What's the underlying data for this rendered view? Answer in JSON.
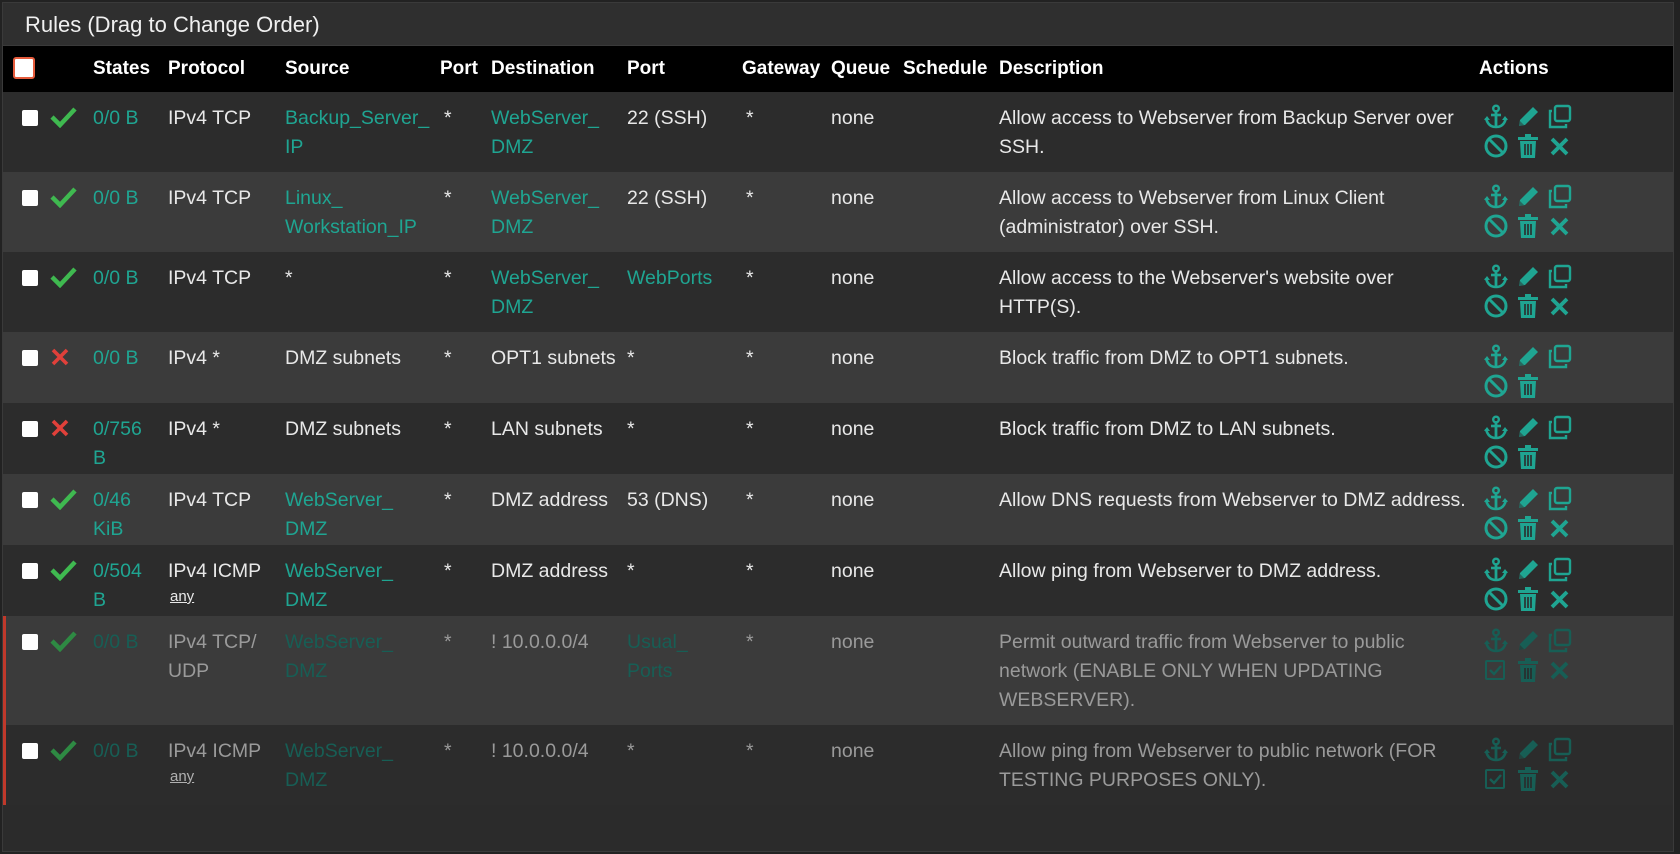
{
  "panel": {
    "title": "Rules (Drag to Change Order)"
  },
  "columns": [
    "States",
    "Protocol",
    "Source",
    "Port",
    "Destination",
    "Port",
    "Gateway",
    "Queue",
    "Schedule",
    "Description",
    "Actions"
  ],
  "colors": {
    "accent": "#1fa592",
    "pass": "#3fb950",
    "block": "#e0403a",
    "disabled_marker": "#c0392b"
  },
  "rules": [
    {
      "status": "pass",
      "disabled": false,
      "states": "0/0 B",
      "protocol": "IPv4 TCP",
      "protocol_sub": "",
      "source": "Backup_Server_ IP",
      "source_link": true,
      "source_port": "*",
      "destination": "WebServer_ DMZ",
      "destination_link": true,
      "dest_port": "22 (SSH)",
      "dest_port_link": false,
      "gateway": "*",
      "queue": "none",
      "schedule": "",
      "description": "Allow access to Webserver from Backup Server over SSH.",
      "actions": [
        "anchor-icon",
        "pencil-icon",
        "copy-icon",
        "ban-icon",
        "trash-icon",
        "times-icon"
      ]
    },
    {
      "status": "pass",
      "disabled": false,
      "states": "0/0 B",
      "protocol": "IPv4 TCP",
      "protocol_sub": "",
      "source": "Linux_ Workstation_IP",
      "source_link": true,
      "source_port": "*",
      "destination": "WebServer_ DMZ",
      "destination_link": true,
      "dest_port": "22 (SSH)",
      "dest_port_link": false,
      "gateway": "*",
      "queue": "none",
      "schedule": "",
      "description": "Allow access to Webserver from Linux Client (administrator) over SSH.",
      "actions": [
        "anchor-icon",
        "pencil-icon",
        "copy-icon",
        "ban-icon",
        "trash-icon",
        "times-icon"
      ]
    },
    {
      "status": "pass",
      "disabled": false,
      "states": "0/0 B",
      "protocol": "IPv4 TCP",
      "protocol_sub": "",
      "source": "*",
      "source_link": false,
      "source_port": "*",
      "destination": "WebServer_ DMZ",
      "destination_link": true,
      "dest_port": "WebPorts",
      "dest_port_link": true,
      "gateway": "*",
      "queue": "none",
      "schedule": "",
      "description": "Allow access to the Webserver's website over HTTP(S).",
      "actions": [
        "anchor-icon",
        "pencil-icon",
        "copy-icon",
        "ban-icon",
        "trash-icon",
        "times-icon"
      ]
    },
    {
      "status": "block",
      "disabled": false,
      "states": "0/0 B",
      "protocol": "IPv4 *",
      "protocol_sub": "",
      "source": "DMZ subnets",
      "source_link": false,
      "source_port": "*",
      "destination": "OPT1 subnets",
      "destination_link": false,
      "dest_port": "*",
      "dest_port_link": false,
      "gateway": "*",
      "queue": "none",
      "schedule": "",
      "description": "Block traffic from DMZ to OPT1 subnets.",
      "actions": [
        "anchor-icon",
        "pencil-icon",
        "copy-icon",
        "ban-icon",
        "trash-icon"
      ]
    },
    {
      "status": "block",
      "disabled": false,
      "states": "0/756 B",
      "protocol": "IPv4 *",
      "protocol_sub": "",
      "source": "DMZ subnets",
      "source_link": false,
      "source_port": "*",
      "destination": "LAN subnets",
      "destination_link": false,
      "dest_port": "*",
      "dest_port_link": false,
      "gateway": "*",
      "queue": "none",
      "schedule": "",
      "description": "Block traffic from DMZ to LAN subnets.",
      "actions": [
        "anchor-icon",
        "pencil-icon",
        "copy-icon",
        "ban-icon",
        "trash-icon"
      ]
    },
    {
      "status": "pass",
      "disabled": false,
      "states": "0/46 KiB",
      "protocol": "IPv4 TCP",
      "protocol_sub": "",
      "source": "WebServer_ DMZ",
      "source_link": true,
      "source_port": "*",
      "destination": "DMZ address",
      "destination_link": false,
      "dest_port": "53 (DNS)",
      "dest_port_link": false,
      "gateway": "*",
      "queue": "none",
      "schedule": "",
      "description": "Allow DNS requests from Webserver to DMZ address.",
      "actions": [
        "anchor-icon",
        "pencil-icon",
        "copy-icon",
        "ban-icon",
        "trash-icon",
        "times-icon"
      ]
    },
    {
      "status": "pass",
      "disabled": false,
      "states": "0/504 B",
      "protocol": "IPv4 ICMP",
      "protocol_sub": "any",
      "source": "WebServer_ DMZ",
      "source_link": true,
      "source_port": "*",
      "destination": "DMZ address",
      "destination_link": false,
      "dest_port": "*",
      "dest_port_link": false,
      "gateway": "*",
      "queue": "none",
      "schedule": "",
      "description": "Allow ping from Webserver to DMZ address.",
      "actions": [
        "anchor-icon",
        "pencil-icon",
        "copy-icon",
        "ban-icon",
        "trash-icon",
        "times-icon"
      ]
    },
    {
      "status": "pass",
      "disabled": true,
      "states": "0/0 B",
      "protocol": "IPv4 TCP/ UDP",
      "protocol_sub": "",
      "source": "WebServer_ DMZ",
      "source_link": true,
      "source_port": "*",
      "destination": "! 10.0.0.0/4",
      "destination_link": false,
      "dest_port": "Usual_ Ports",
      "dest_port_link": true,
      "gateway": "*",
      "queue": "none",
      "schedule": "",
      "description": "Permit outward traffic from Webserver to public network (ENABLE ONLY WHEN UPDATING WEBSERVER).",
      "actions": [
        "anchor-icon",
        "pencil-icon",
        "copy-icon",
        "check-square-icon",
        "trash-icon",
        "times-icon"
      ]
    },
    {
      "status": "pass",
      "disabled": true,
      "states": "0/0 B",
      "protocol": "IPv4 ICMP",
      "protocol_sub": "any",
      "source": "WebServer_ DMZ",
      "source_link": true,
      "source_port": "*",
      "destination": "! 10.0.0.0/4",
      "destination_link": false,
      "dest_port": "*",
      "dest_port_link": false,
      "gateway": "*",
      "queue": "none",
      "schedule": "",
      "description": "Allow ping from Webserver to public network (FOR TESTING PURPOSES ONLY).",
      "actions": [
        "anchor-icon",
        "pencil-icon",
        "copy-icon",
        "check-square-icon",
        "trash-icon",
        "times-icon"
      ]
    }
  ]
}
